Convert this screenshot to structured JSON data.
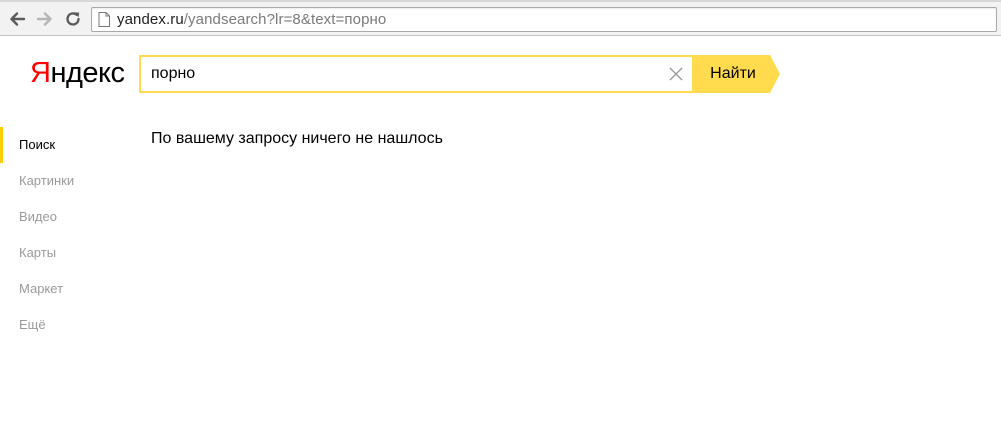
{
  "browser": {
    "url_host": "yandex.ru",
    "url_path": "/yandsearch?lr=8&text=порно"
  },
  "header": {
    "logo_first_letter": "Я",
    "logo_rest": "ндекс",
    "search_value": "порно",
    "find_button_label": "Найти"
  },
  "sidebar": {
    "items": [
      {
        "label": "Поиск",
        "active": true
      },
      {
        "label": "Картинки",
        "active": false
      },
      {
        "label": "Видео",
        "active": false
      },
      {
        "label": "Карты",
        "active": false
      },
      {
        "label": "Маркет",
        "active": false
      },
      {
        "label": "Ещё",
        "active": false
      }
    ]
  },
  "main": {
    "message": "По вашему запросу ничего не нашлось"
  },
  "colors": {
    "accent": "#ffdb4d",
    "active_marker": "#ffcc00",
    "logo_red": "#ff0000",
    "inactive_text": "#9a9a9a"
  }
}
